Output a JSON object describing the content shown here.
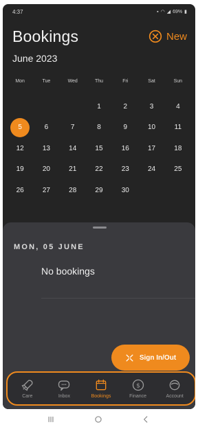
{
  "status_bar": {
    "time": "4:37",
    "battery": "69%"
  },
  "header": {
    "title": "Bookings",
    "new_label": "New"
  },
  "month_label": "June 2023",
  "weekdays": [
    "Mon",
    "Tue",
    "Wed",
    "Thu",
    "Fri",
    "Sat",
    "Sun"
  ],
  "calendar": {
    "weeks": [
      [
        "",
        "",
        "",
        "1",
        "2",
        "3",
        "4"
      ],
      [
        "5",
        "6",
        "7",
        "8",
        "9",
        "10",
        "11"
      ],
      [
        "12",
        "13",
        "14",
        "15",
        "16",
        "17",
        "18"
      ],
      [
        "19",
        "20",
        "21",
        "22",
        "23",
        "24",
        "25"
      ],
      [
        "26",
        "27",
        "28",
        "29",
        "30",
        "",
        ""
      ]
    ],
    "selected": "5"
  },
  "sheet": {
    "date_heading": "MON, 05 JUNE",
    "empty_message": "No bookings",
    "sign_button_label": "Sign In/Out"
  },
  "bottom_nav": {
    "items": [
      {
        "label": "Care",
        "icon": "rocket-icon"
      },
      {
        "label": "Inbox",
        "icon": "chat-icon"
      },
      {
        "label": "Bookings",
        "icon": "calendar-icon"
      },
      {
        "label": "Finance",
        "icon": "dollar-icon"
      },
      {
        "label": "Account",
        "icon": "account-icon"
      }
    ],
    "active": "Bookings"
  },
  "colors": {
    "accent": "#ef8a1e",
    "background": "#242424",
    "sheet": "#3a3a3e"
  }
}
